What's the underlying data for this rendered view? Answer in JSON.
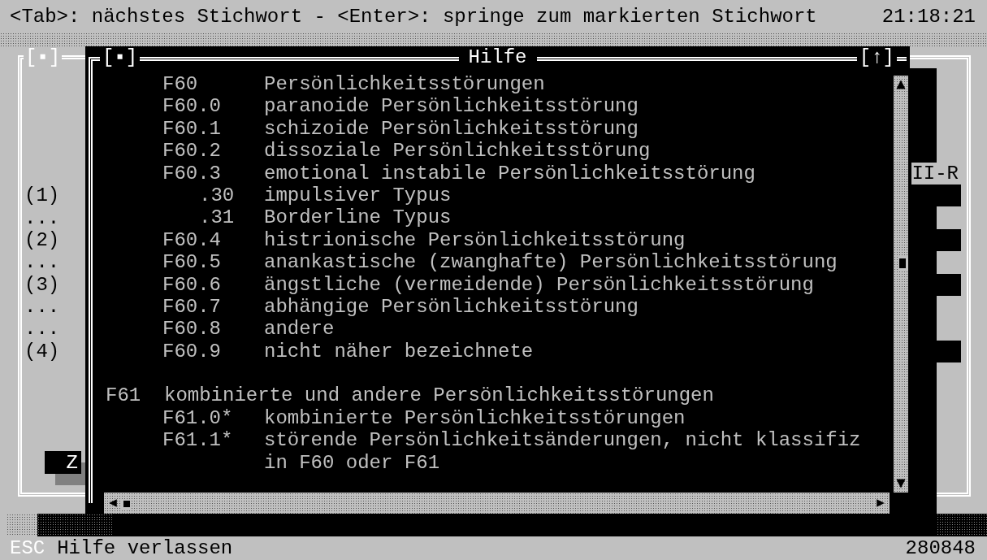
{
  "top_bar": {
    "hint": "<Tab>: nächstes Stichwort - <Enter>: springe zum markierten Stichwort",
    "clock": "21:18:21"
  },
  "background_window": {
    "close_box": "[▪]",
    "side_label": "II-R",
    "button": "Z",
    "markers": [
      {
        "text": "(1)",
        "kind": "field"
      },
      {
        "text": "...",
        "kind": "gap"
      },
      {
        "text": "(2)",
        "kind": "field"
      },
      {
        "text": "...",
        "kind": "gap"
      },
      {
        "text": "(3)",
        "kind": "field"
      },
      {
        "text": "...",
        "kind": "gap"
      },
      {
        "text": "...",
        "kind": "gap"
      },
      {
        "text": "(4)",
        "kind": "field"
      }
    ]
  },
  "help_window": {
    "close_box": "[▪]",
    "title": "Hilfe",
    "zoom_box": "[↑]",
    "lines": [
      {
        "kind": "item",
        "code": "F60",
        "text": "Persönlichkeitsstörungen"
      },
      {
        "kind": "item",
        "code": "F60.0",
        "text": "paranoide Persönlichkeitsstörung"
      },
      {
        "kind": "item",
        "code": "F60.1",
        "text": "schizoide Persönlichkeitsstörung"
      },
      {
        "kind": "item",
        "code": "F60.2",
        "text": "dissoziale Persönlichkeitsstörung"
      },
      {
        "kind": "item",
        "code": "F60.3",
        "text": "emotional instabile Persönlichkeitsstörung"
      },
      {
        "kind": "sub",
        "code": ".30",
        "text": "impulsiver Typus"
      },
      {
        "kind": "sub",
        "code": ".31",
        "text": "Borderline Typus"
      },
      {
        "kind": "item",
        "code": "F60.4",
        "text": "histrionische Persönlichkeitsstörung"
      },
      {
        "kind": "item",
        "code": "F60.5",
        "text": "anankastische (zwanghafte) Persönlichkeitsstörung"
      },
      {
        "kind": "item",
        "code": "F60.6",
        "text": "ängstliche (vermeidende) Persönlichkeitsstörung"
      },
      {
        "kind": "item",
        "code": "F60.7",
        "text": "abhängige Persönlichkeitsstörung"
      },
      {
        "kind": "item",
        "code": "F60.8",
        "text": "andere"
      },
      {
        "kind": "item",
        "code": "F60.9",
        "text": "nicht näher bezeichnete"
      },
      {
        "kind": "group",
        "code": "F61",
        "text": "kombinierte und andere Persönlichkeitsstörungen"
      },
      {
        "kind": "item",
        "code": "F61.0*",
        "text": "kombinierte Persönlichkeitsstörungen"
      },
      {
        "kind": "item",
        "code": "F61.1*",
        "text": "störende Persönlichkeitsänderungen, nicht klassifiz"
      },
      {
        "kind": "cont",
        "text": "in F60 oder F61"
      }
    ]
  },
  "status_bar": {
    "key": "ESC",
    "action": "Hilfe verlassen",
    "code": "280848"
  }
}
